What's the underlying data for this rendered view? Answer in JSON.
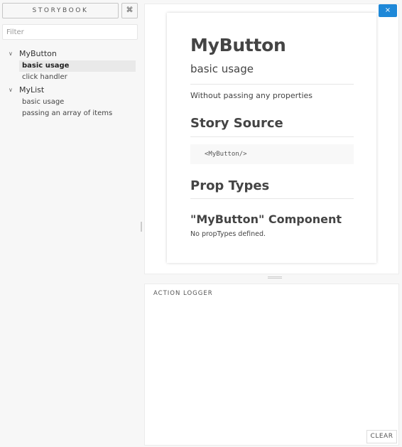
{
  "sidebar": {
    "brand": "STORYBOOK",
    "shortcut_icon": "⌘",
    "filter_placeholder": "Filter",
    "kinds": [
      {
        "label": "MyButton",
        "stories": [
          "basic usage",
          "click handler"
        ]
      },
      {
        "label": "MyList",
        "stories": [
          "basic usage",
          "passing an array of items"
        ]
      }
    ],
    "chevron": "∨"
  },
  "preview": {
    "close_label": "×",
    "title": "MyButton",
    "subtitle": "basic usage",
    "description": "Without passing any properties",
    "story_source_heading": "Story Source",
    "story_source_code": "<MyButton/>",
    "prop_types_heading": "Prop Types",
    "component_heading": "\"MyButton\" Component",
    "no_prop_types": "No propTypes defined."
  },
  "logger": {
    "title": "ACTION LOGGER",
    "clear_label": "CLEAR"
  }
}
